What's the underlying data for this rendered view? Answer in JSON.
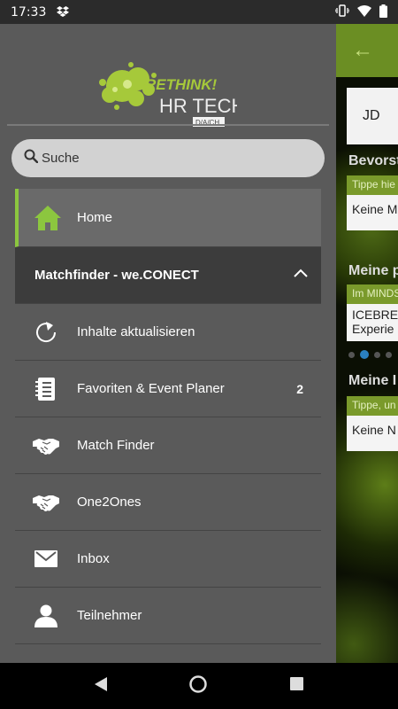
{
  "status_bar": {
    "time": "17:33"
  },
  "background_app": {
    "avatar_initials": "JD",
    "section_1": {
      "title": "Bevorst",
      "hint": "Tippe hie",
      "box": "Keine M"
    },
    "section_2": {
      "title": "Meine p",
      "hint": "Im MINDS",
      "box_line1": "ICEBREA",
      "box_line2": "Experie"
    },
    "section_3": {
      "title": "Meine I",
      "hint": "Tippe, un",
      "box": "Keine N"
    }
  },
  "drawer": {
    "logo": {
      "word1": "RETHINK!",
      "word2": "HR TECH",
      "region": "D/A/CH"
    },
    "search": {
      "placeholder": "Suche"
    },
    "items": [
      {
        "label": "Home",
        "icon": "home-icon"
      },
      {
        "label": "Matchfinder - we.CONECT",
        "icon": "chevron-up-icon"
      },
      {
        "label": "Inhalte aktualisieren",
        "icon": "refresh-icon"
      },
      {
        "label": "Favoriten & Event Planer",
        "icon": "notebook-icon",
        "badge": "2"
      },
      {
        "label": "Match Finder",
        "icon": "handshake-icon"
      },
      {
        "label": "One2Ones",
        "icon": "handshake-icon"
      },
      {
        "label": "Inbox",
        "icon": "mail-icon"
      },
      {
        "label": "Teilnehmer",
        "icon": "person-icon"
      }
    ]
  },
  "colors": {
    "accent": "#8cc63f",
    "drawer_bg": "#5a5a5a",
    "section_bg": "#3c3c3c",
    "toolbar": "#6b8e23"
  }
}
